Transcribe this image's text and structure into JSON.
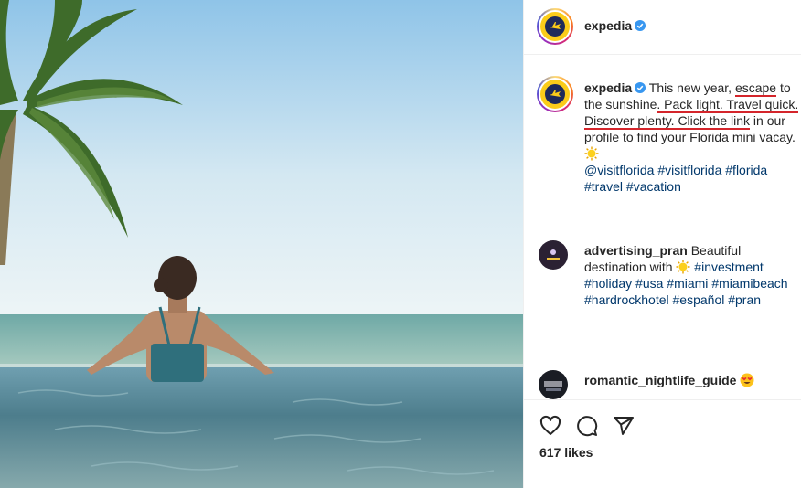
{
  "post": {
    "username": "expedia",
    "caption_parts": [
      "This new year, ",
      "escape",
      " to the sunshine",
      ". Pack light. Travel quick.",
      " ",
      "Discover plenty. Click the link",
      " in our profile to find your Florida mini vacay."
    ],
    "caption_tags": [
      "@visitflorida",
      "#visitflorida",
      "#florida",
      "#travel",
      "#vacation"
    ],
    "annotation_color": "#d4252b"
  },
  "comments": [
    {
      "username": "advertising_pran",
      "text_before": "Beautiful destination with",
      "emoji": "sun",
      "tags": [
        "#investment",
        "#holiday",
        "#usa",
        "#miami",
        "#miamibeach",
        "#hardrockhotel",
        "#español",
        "#pran"
      ]
    },
    {
      "username": "romantic_nightlife_guide",
      "emoji": "heart-eyes"
    }
  ],
  "actions": {
    "icons": [
      "heart-icon",
      "comment-icon",
      "share-icon"
    ],
    "likes_text": "617 likes"
  },
  "colors": {
    "link": "#00376b",
    "verified": "#3897f0",
    "text": "#262626"
  }
}
